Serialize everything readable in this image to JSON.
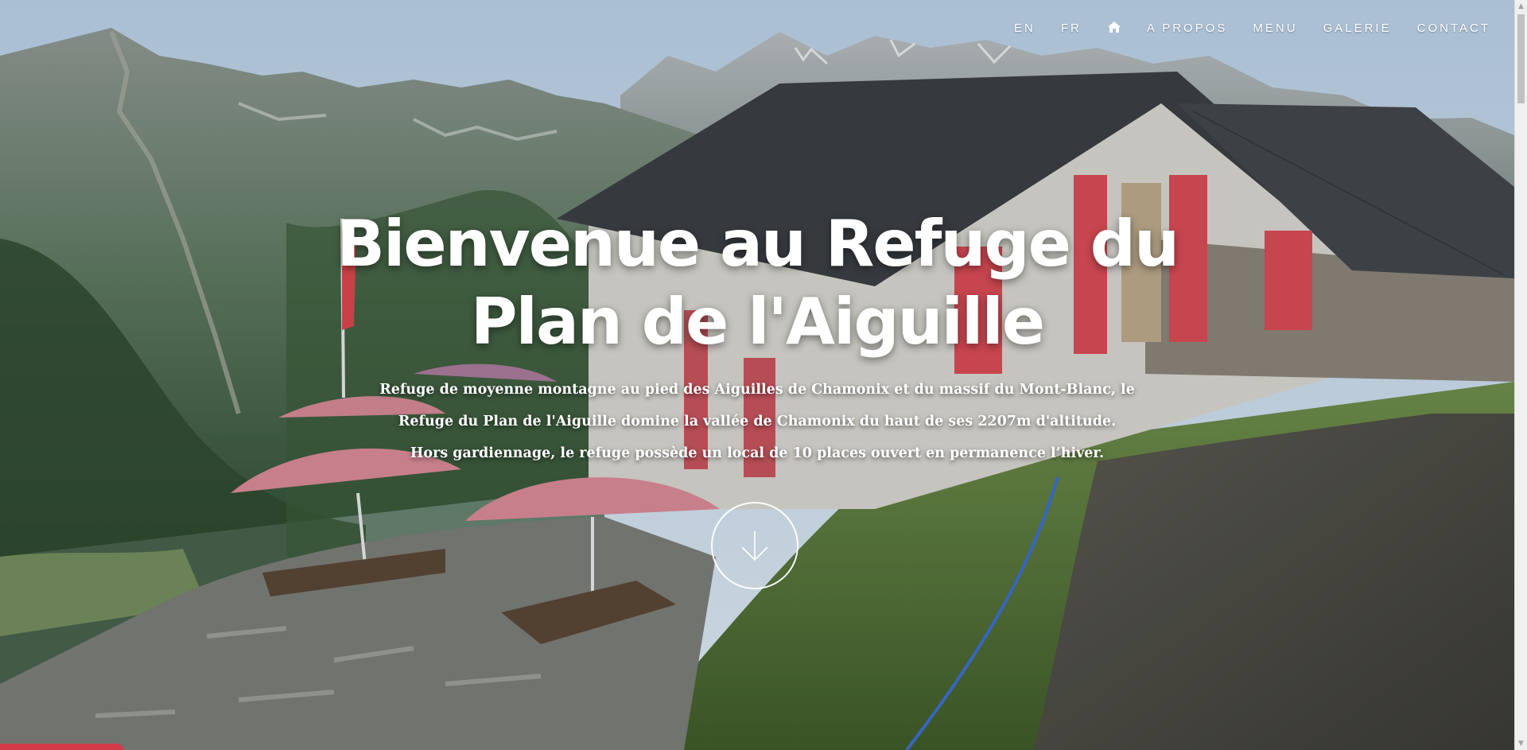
{
  "nav": {
    "items": [
      {
        "label": "EN"
      },
      {
        "label": "FR"
      },
      {
        "label": "",
        "icon": "home-icon"
      },
      {
        "label": "A PROPOS"
      },
      {
        "label": "MENU"
      },
      {
        "label": "GALERIE"
      },
      {
        "label": "CONTACT"
      }
    ]
  },
  "hero": {
    "title_line1": "Bienvenue au Refuge du",
    "title_line2": "Plan de l'Aiguille",
    "lead_line1": "Refuge de moyenne montagne au pied des Aiguilles de Chamonix et du massif du Mont-Blanc, le",
    "lead_line2": "Refuge du Plan de l'Aiguille domine la vallée de Chamonix du haut de ses 2207m d'altitude.",
    "lead_line3": "Hors gardiennage, le refuge possède un local de 10 places ouvert en permanence l’hiver.",
    "scroll_icon": "arrow-down-icon"
  },
  "colors": {
    "text": "#ffffff",
    "roof": "#3b3f44",
    "shutter": "#d84b55",
    "umbrella": "#d88a97"
  }
}
